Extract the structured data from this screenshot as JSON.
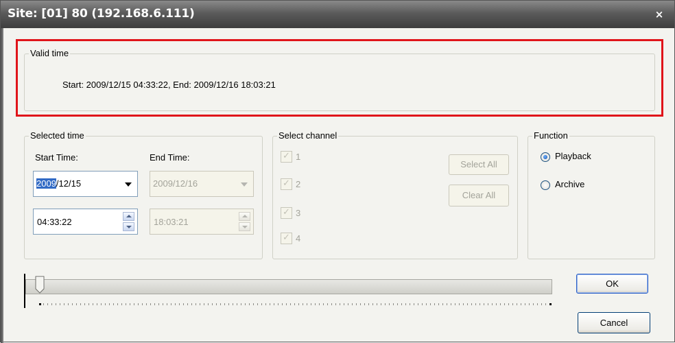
{
  "window": {
    "title": "Site: [01] 80 (192.168.6.111)",
    "close_symbol": "×"
  },
  "valid_time": {
    "legend": "Valid time",
    "text": "Start: 2009/12/15 04:33:22,  End: 2009/12/16 18:03:21"
  },
  "selected_time": {
    "legend": "Selected time",
    "start_label": "Start Time:",
    "end_label": "End Time:",
    "start_date_year": "2009",
    "start_date_rest": "/12/15",
    "end_date": "2009/12/16",
    "start_time": "04:33:22",
    "end_time": "18:03:21"
  },
  "select_channel": {
    "legend": "Select channel",
    "channels": [
      "1",
      "2",
      "3",
      "4"
    ],
    "select_all": "Select All",
    "clear_all": "Clear All"
  },
  "function": {
    "legend": "Function",
    "options": [
      "Playback",
      "Archive"
    ],
    "selected": "Playback"
  },
  "buttons": {
    "ok": "OK",
    "cancel": "Cancel"
  },
  "slider": {
    "position_fraction": 0.0
  },
  "colors": {
    "highlight_box": "#e0141a",
    "selection": "#316ac5"
  },
  "icons": {
    "close": "close-icon",
    "dropdown": "chevron-down-icon",
    "spin_up": "spin-up-icon",
    "spin_down": "spin-down-icon"
  }
}
